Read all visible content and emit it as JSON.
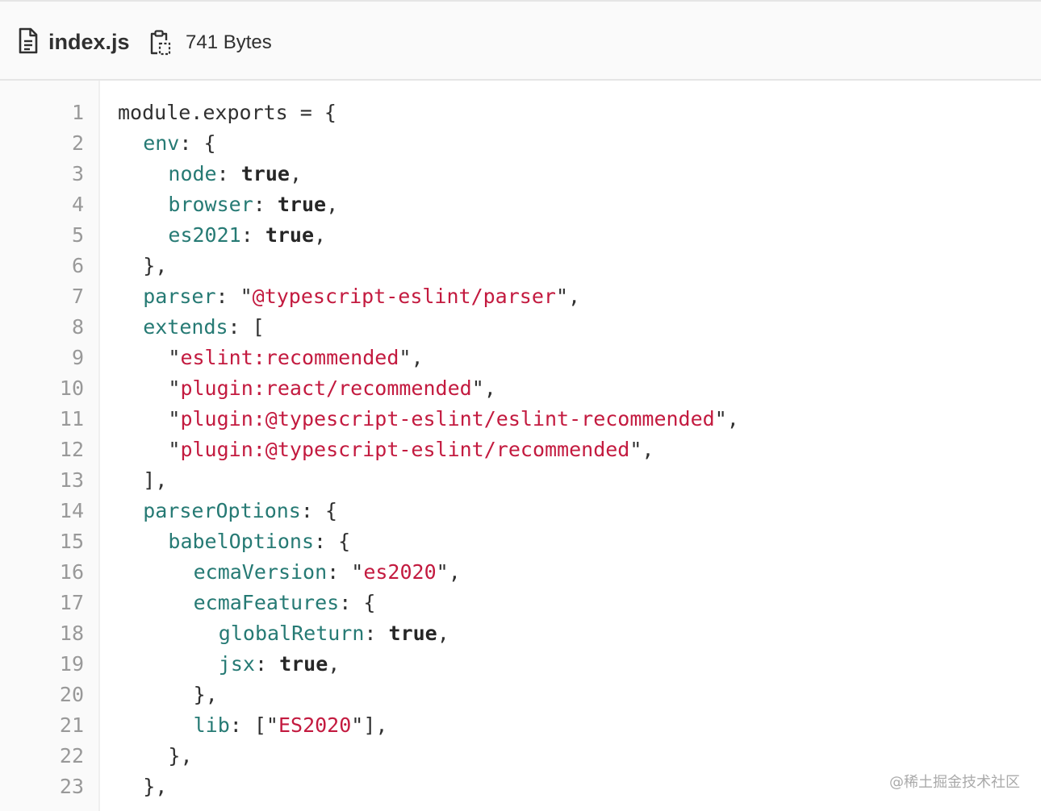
{
  "file": {
    "name": "index.js",
    "size": "741 Bytes",
    "icons": {
      "file": "file-text-icon",
      "copy": "clipboard-copy-icon"
    }
  },
  "colors": {
    "key": "#267a74",
    "string": "#c31a3f",
    "keyword": "#262626",
    "punctuation": "#303030",
    "line_number": "#999999"
  },
  "code": {
    "lines": [
      {
        "n": "1",
        "indent": 0,
        "tokens": [
          {
            "t": "plain",
            "v": "module.exports = {"
          }
        ]
      },
      {
        "n": "2",
        "indent": 1,
        "tokens": [
          {
            "t": "key",
            "v": "env"
          },
          {
            "t": "plain",
            "v": ": {"
          }
        ]
      },
      {
        "n": "3",
        "indent": 2,
        "tokens": [
          {
            "t": "key",
            "v": "node"
          },
          {
            "t": "plain",
            "v": ": "
          },
          {
            "t": "bool",
            "v": "true"
          },
          {
            "t": "plain",
            "v": ","
          }
        ]
      },
      {
        "n": "4",
        "indent": 2,
        "tokens": [
          {
            "t": "key",
            "v": "browser"
          },
          {
            "t": "plain",
            "v": ": "
          },
          {
            "t": "bool",
            "v": "true"
          },
          {
            "t": "plain",
            "v": ","
          }
        ]
      },
      {
        "n": "5",
        "indent": 2,
        "tokens": [
          {
            "t": "key",
            "v": "es2021"
          },
          {
            "t": "plain",
            "v": ": "
          },
          {
            "t": "bool",
            "v": "true"
          },
          {
            "t": "plain",
            "v": ","
          }
        ]
      },
      {
        "n": "6",
        "indent": 1,
        "tokens": [
          {
            "t": "plain",
            "v": "},"
          }
        ]
      },
      {
        "n": "7",
        "indent": 1,
        "tokens": [
          {
            "t": "key",
            "v": "parser"
          },
          {
            "t": "plain",
            "v": ": \""
          },
          {
            "t": "str",
            "v": "@typescript-eslint/parser"
          },
          {
            "t": "plain",
            "v": "\","
          }
        ]
      },
      {
        "n": "8",
        "indent": 1,
        "tokens": [
          {
            "t": "key",
            "v": "extends"
          },
          {
            "t": "plain",
            "v": ": ["
          }
        ]
      },
      {
        "n": "9",
        "indent": 2,
        "tokens": [
          {
            "t": "plain",
            "v": "\""
          },
          {
            "t": "str",
            "v": "eslint:recommended"
          },
          {
            "t": "plain",
            "v": "\","
          }
        ]
      },
      {
        "n": "10",
        "indent": 2,
        "tokens": [
          {
            "t": "plain",
            "v": "\""
          },
          {
            "t": "str",
            "v": "plugin:react/recommended"
          },
          {
            "t": "plain",
            "v": "\","
          }
        ]
      },
      {
        "n": "11",
        "indent": 2,
        "tokens": [
          {
            "t": "plain",
            "v": "\""
          },
          {
            "t": "str",
            "v": "plugin:@typescript-eslint/eslint-recommended"
          },
          {
            "t": "plain",
            "v": "\","
          }
        ]
      },
      {
        "n": "12",
        "indent": 2,
        "tokens": [
          {
            "t": "plain",
            "v": "\""
          },
          {
            "t": "str",
            "v": "plugin:@typescript-eslint/recommended"
          },
          {
            "t": "plain",
            "v": "\","
          }
        ]
      },
      {
        "n": "13",
        "indent": 1,
        "tokens": [
          {
            "t": "plain",
            "v": "],"
          }
        ]
      },
      {
        "n": "14",
        "indent": 1,
        "tokens": [
          {
            "t": "key",
            "v": "parserOptions"
          },
          {
            "t": "plain",
            "v": ": {"
          }
        ]
      },
      {
        "n": "15",
        "indent": 2,
        "tokens": [
          {
            "t": "key",
            "v": "babelOptions"
          },
          {
            "t": "plain",
            "v": ": {"
          }
        ]
      },
      {
        "n": "16",
        "indent": 3,
        "tokens": [
          {
            "t": "key",
            "v": "ecmaVersion"
          },
          {
            "t": "plain",
            "v": ": \""
          },
          {
            "t": "str",
            "v": "es2020"
          },
          {
            "t": "plain",
            "v": "\","
          }
        ]
      },
      {
        "n": "17",
        "indent": 3,
        "tokens": [
          {
            "t": "key",
            "v": "ecmaFeatures"
          },
          {
            "t": "plain",
            "v": ": {"
          }
        ]
      },
      {
        "n": "18",
        "indent": 4,
        "tokens": [
          {
            "t": "key",
            "v": "globalReturn"
          },
          {
            "t": "plain",
            "v": ": "
          },
          {
            "t": "bool",
            "v": "true"
          },
          {
            "t": "plain",
            "v": ","
          }
        ]
      },
      {
        "n": "19",
        "indent": 4,
        "tokens": [
          {
            "t": "key",
            "v": "jsx"
          },
          {
            "t": "plain",
            "v": ": "
          },
          {
            "t": "bool",
            "v": "true"
          },
          {
            "t": "plain",
            "v": ","
          }
        ]
      },
      {
        "n": "20",
        "indent": 3,
        "tokens": [
          {
            "t": "plain",
            "v": "},"
          }
        ]
      },
      {
        "n": "21",
        "indent": 3,
        "tokens": [
          {
            "t": "key",
            "v": "lib"
          },
          {
            "t": "plain",
            "v": ": [\""
          },
          {
            "t": "str",
            "v": "ES2020"
          },
          {
            "t": "plain",
            "v": "\"],"
          }
        ]
      },
      {
        "n": "22",
        "indent": 2,
        "tokens": [
          {
            "t": "plain",
            "v": "},"
          }
        ]
      },
      {
        "n": "23",
        "indent": 1,
        "tokens": [
          {
            "t": "plain",
            "v": "},"
          }
        ]
      }
    ]
  },
  "watermark": "@稀土掘金技术社区"
}
